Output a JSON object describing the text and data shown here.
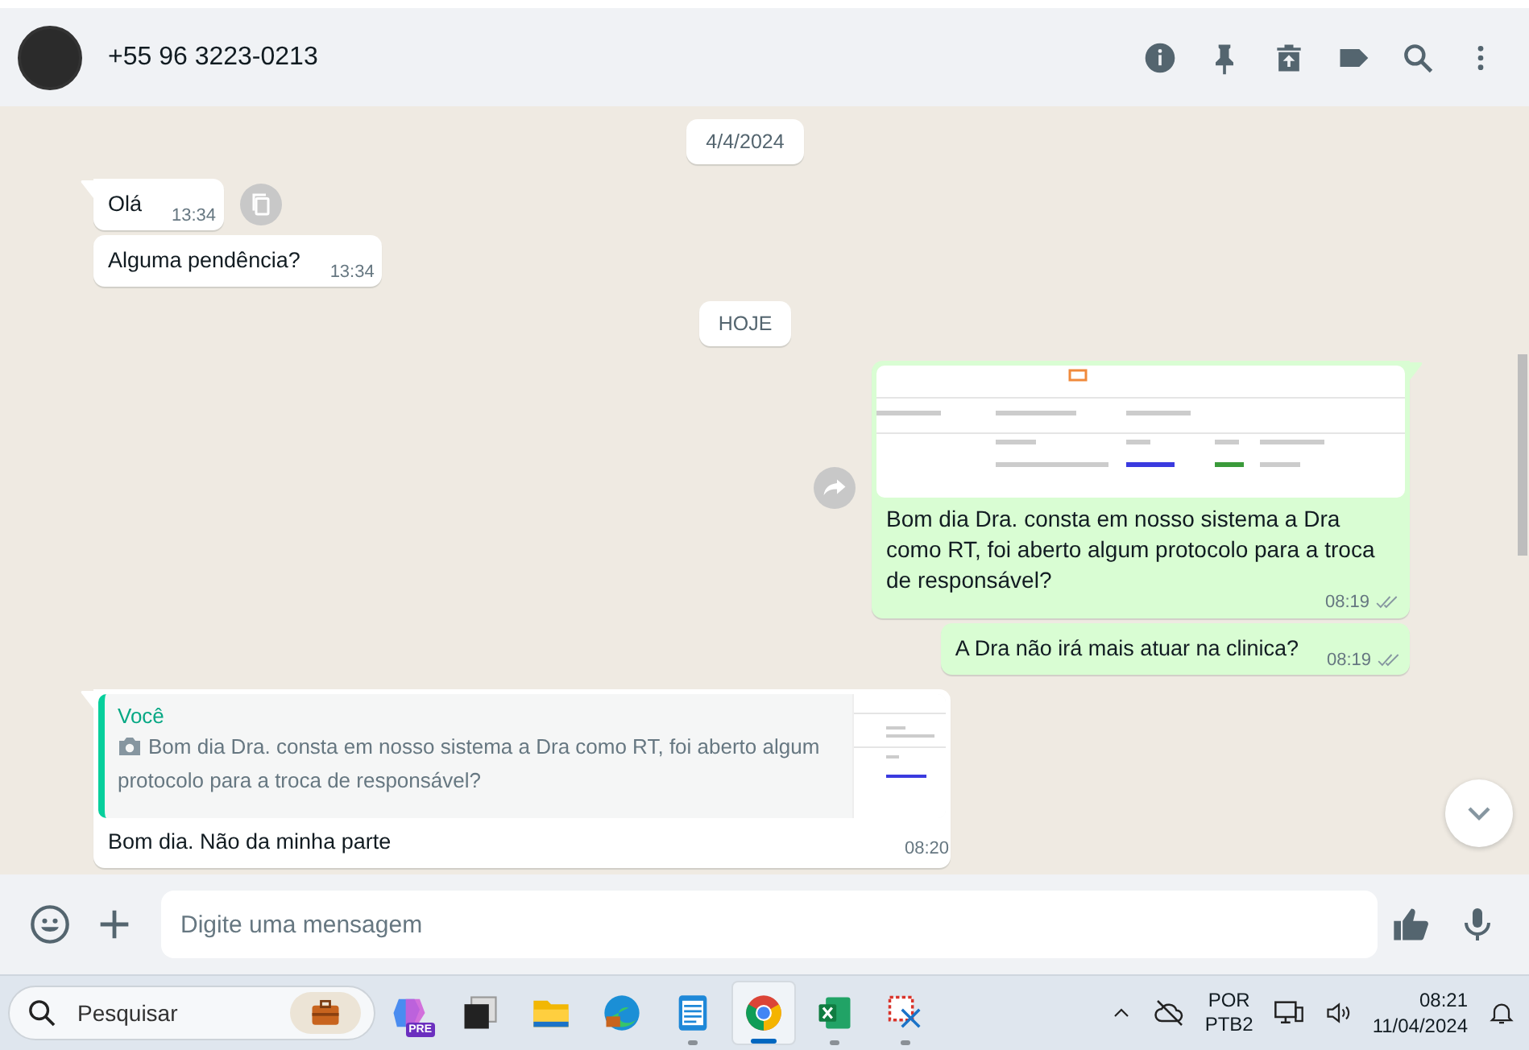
{
  "contact": {
    "name": "+55 96 3223-0213"
  },
  "messages": [
    {
      "kind": "date",
      "text": "4/4/2024"
    },
    {
      "kind": "incoming",
      "tail": true,
      "text": "Olá",
      "time": "13:34",
      "side_button": {
        "kind": "copy"
      }
    },
    {
      "kind": "incoming",
      "tail": false,
      "text": "Alguma pendência?",
      "time": "13:34"
    },
    {
      "kind": "date",
      "text": "HOJE"
    },
    {
      "kind": "outgoing",
      "tail": true,
      "image": true,
      "text": "Bom dia Dra. consta em nosso sistema a Dra como RT, foi aberto algum protocolo para a troca de responsável?",
      "time": "08:19",
      "read": false,
      "side_button": {
        "kind": "forward"
      }
    },
    {
      "kind": "outgoing",
      "tail": false,
      "text": "A Dra não irá mais atuar na clinica?",
      "time": "08:19",
      "read": false
    },
    {
      "kind": "incoming",
      "tail": true,
      "quote": {
        "author": "Você",
        "text": "Bom dia Dra. consta em nosso sistema a Dra como RT, foi aberto algum protocolo para a troca de responsável?",
        "image": true
      },
      "text": "Bom dia. Não da minha parte",
      "time": "08:20"
    }
  ],
  "composer": {
    "placeholder": "Digite uma mensagem"
  },
  "taskbar": {
    "search": {
      "placeholder": "Pesquisar"
    },
    "apps": [
      {
        "kind": "copilot",
        "badge": "PRE",
        "running": false,
        "selected": false
      },
      {
        "kind": "taskview",
        "running": false,
        "selected": false
      },
      {
        "kind": "folder",
        "running": false,
        "selected": false
      },
      {
        "kind": "edge",
        "running": false,
        "selected": false
      },
      {
        "kind": "notepad",
        "running": true,
        "selected": false
      },
      {
        "kind": "chrome",
        "running": true,
        "selected": true
      },
      {
        "kind": "excel",
        "running": true,
        "selected": false
      },
      {
        "kind": "snip",
        "running": true,
        "selected": false
      }
    ],
    "language": {
      "code": "POR",
      "layout": "PTB2"
    },
    "clock": {
      "time": "08:21",
      "date": "11/04/2024"
    }
  }
}
